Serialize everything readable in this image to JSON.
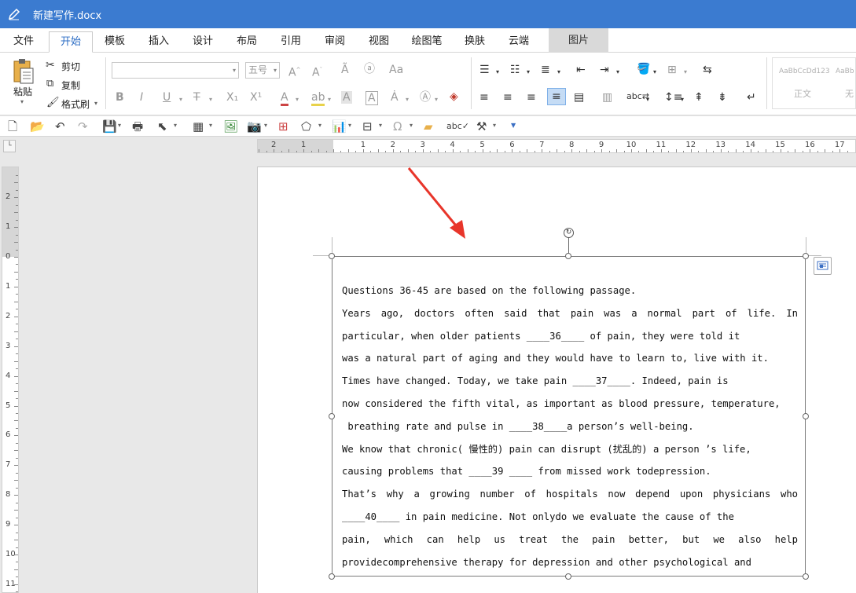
{
  "window": {
    "title": "新建写作.docx"
  },
  "menu": {
    "tabs": [
      {
        "label": "文件",
        "active": false
      },
      {
        "label": "开始",
        "active": true
      },
      {
        "label": "模板",
        "active": false
      },
      {
        "label": "插入",
        "active": false
      },
      {
        "label": "设计",
        "active": false
      },
      {
        "label": "布局",
        "active": false
      },
      {
        "label": "引用",
        "active": false
      },
      {
        "label": "审阅",
        "active": false
      },
      {
        "label": "视图",
        "active": false
      },
      {
        "label": "绘图笔",
        "active": false
      },
      {
        "label": "换肤",
        "active": false
      },
      {
        "label": "云端",
        "active": false
      }
    ],
    "context_tab": "图片"
  },
  "ribbon": {
    "paste_label": "粘贴",
    "cut_label": "剪切",
    "copy_label": "复制",
    "format_painter_label": "格式刷",
    "font_name_value": "",
    "font_size_value": "五号",
    "styles": {
      "sample1": "AaBbCcDd123",
      "sample2": "AaBb",
      "name1": "正文",
      "name2": "无"
    }
  },
  "rulers": {
    "horizontal_numbers": [
      "2",
      "1",
      "1",
      "2",
      "3",
      "4",
      "5",
      "6",
      "7",
      "8",
      "9",
      "10",
      "11",
      "12",
      "13",
      "14",
      "15",
      "16",
      "17"
    ],
    "vertical_numbers": [
      "2",
      "1",
      "0",
      "1",
      "2",
      "3",
      "4",
      "5",
      "6",
      "7",
      "8",
      "9",
      "10",
      "11"
    ]
  },
  "document": {
    "lines": [
      "Questions 36-45 are based on the following passage.",
      "Years ago, doctors often said that pain was a normal part of life. In",
      "particular, when older patients ____36____ of pain, they were told it",
      "was a natural part of aging and they would have to learn to, live with it.",
      "Times have changed. Today, we take pain ____37____. Indeed, pain is",
      "now considered the fifth vital, as important as blood pressure, temperature,",
      " breathing rate and pulse in ____38____a person’s well-being.",
      "We know that chronic( 慢性的) pain can disrupt (扰乱的) a person ’s life,",
      "causing problems that ____39 ____ from missed work todepression.",
      "That’s why a growing number of hospitals now depend upon physicians who",
      "____40____ in pain medicine. Not onlydo we evaluate the cause of the",
      "pain, which can help us treat the pain better, but we also help",
      "providecomprehensive therapy for depression and other psychological and"
    ]
  },
  "colors": {
    "titlebar": "#3b7bd0",
    "active_tab_text": "#2b6cc4",
    "annotation_arrow": "#e8352a"
  }
}
